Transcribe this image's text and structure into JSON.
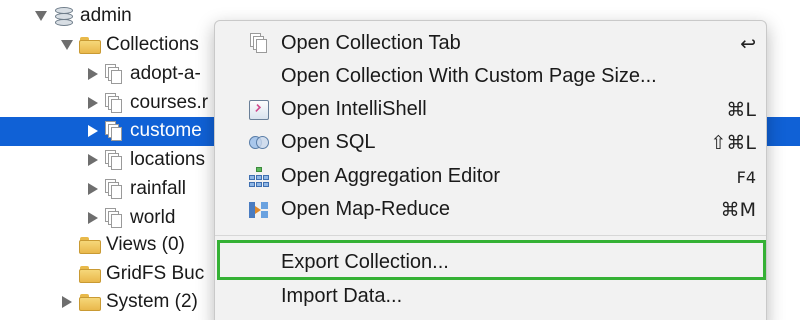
{
  "tree": {
    "db_name": "admin",
    "collections_label": "Collections",
    "collections": [
      "adopt-a-",
      "courses.r",
      "custome",
      "locations",
      "rainfall",
      "world"
    ],
    "views_label": "Views (0)",
    "gridfs_label": "GridFS Buc",
    "system_label": "System (2)"
  },
  "menu": {
    "items": [
      {
        "label": "Open Collection Tab",
        "shortcut": "↩"
      },
      {
        "label": "Open Collection With Custom Page Size...",
        "shortcut": ""
      },
      {
        "label": "Open IntelliShell",
        "shortcut": "⌘L"
      },
      {
        "label": "Open SQL",
        "shortcut": "⇧⌘L"
      },
      {
        "label": "Open Aggregation Editor",
        "shortcut": "F4"
      },
      {
        "label": "Open Map-Reduce",
        "shortcut": "⌘M"
      },
      {
        "label": "Export Collection...",
        "shortcut": ""
      },
      {
        "label": "Import Data...",
        "shortcut": ""
      }
    ]
  },
  "colors": {
    "selection": "#1061d6",
    "highlight_border": "#35b135"
  },
  "icons": {
    "db": "database-icon",
    "folder": "folder-icon",
    "collection": "collection-icon",
    "tab": "collection-tab-icon",
    "shell": "intellishell-icon",
    "sql": "sql-icon",
    "aggregation": "aggregation-icon",
    "mapreduce": "map-reduce-icon"
  }
}
